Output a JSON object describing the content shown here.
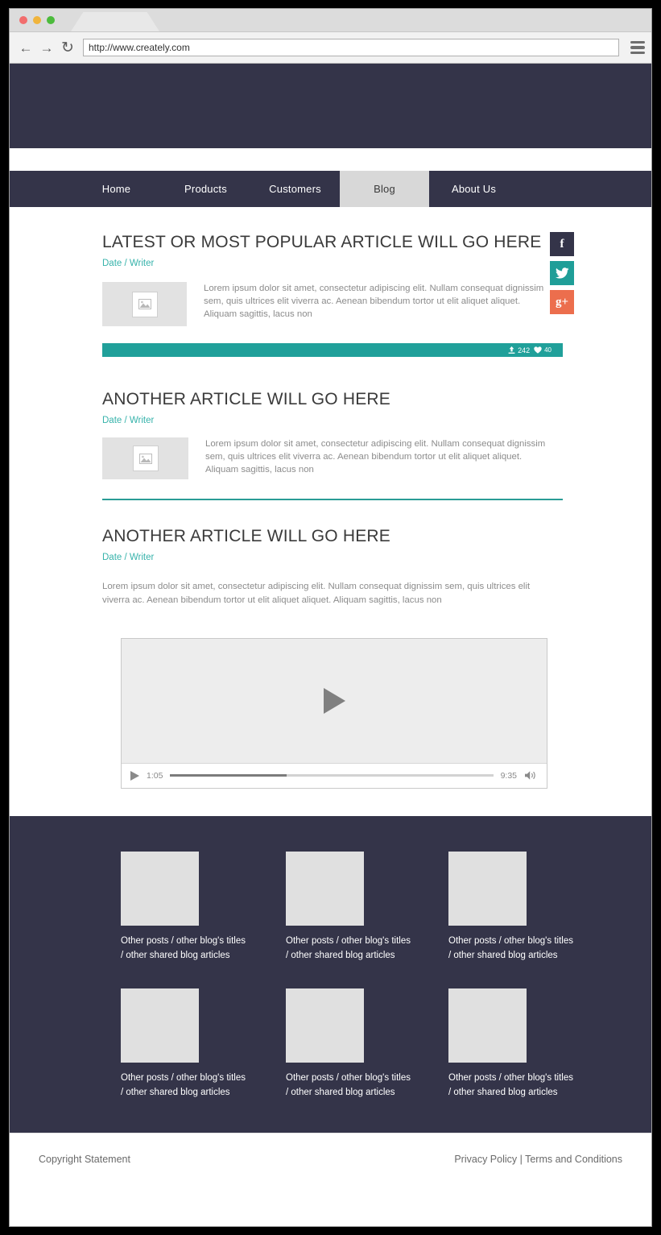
{
  "browser": {
    "url": "http://www.creately.com",
    "back_icon": "back-arrow-icon",
    "forward_icon": "forward-arrow-icon",
    "reload_icon": "reload-icon",
    "menu_icon": "hamburger-menu-icon",
    "lights": [
      "close-light",
      "minimize-light",
      "maximize-light"
    ]
  },
  "nav": {
    "items": [
      {
        "label": "Home",
        "active": false
      },
      {
        "label": "Products",
        "active": false
      },
      {
        "label": "Customers",
        "active": false
      },
      {
        "label": "Blog",
        "active": true
      },
      {
        "label": "About Us",
        "active": false
      }
    ]
  },
  "social": [
    {
      "name": "facebook-share-button",
      "glyph": "f",
      "color": "#343449"
    },
    {
      "name": "twitter-share-button",
      "glyph": "♥",
      "color": "#1f9e98"
    },
    {
      "name": "googleplus-share-button",
      "glyph": "g+",
      "color": "#ec6e4d"
    }
  ],
  "articles": [
    {
      "title": "LATEST OR MOST POPULAR ARTICLE WILL GO HERE",
      "byline": "Date / Writer",
      "body": "Lorem ipsum dolor sit amet, consectetur adipiscing elit. Nullam consequat dignissim sem, quis ultrices elit viverra ac. Aenean bibendum tortor ut elit aliquet aliquet. Aliquam sagittis, lacus non"
    },
    {
      "title": "ANOTHER ARTICLE WILL GO HERE",
      "byline": "Date / Writer",
      "body": "Lorem ipsum dolor sit amet, consectetur adipiscing elit. Nullam consequat dignissim sem, quis ultrices elit viverra ac. Aenean bibendum tortor ut elit aliquet aliquet. Aliquam sagittis, lacus non"
    },
    {
      "title": "ANOTHER ARTICLE WILL GO HERE",
      "byline": "Date / Writer",
      "body": "Lorem ipsum dolor sit amet, consectetur adipiscing elit. Nullam consequat dignissim sem, quis ultrices elit viverra ac. Aenean bibendum tortor ut elit aliquet aliquet. Aliquam sagittis, lacus non"
    }
  ],
  "stats": {
    "shares": "242",
    "likes": "40",
    "share_icon": "upload-share-icon",
    "like_icon": "heart-icon",
    "bar_color": "#20a09a"
  },
  "video": {
    "play_icon": "play-icon",
    "current_time": "1:05",
    "duration": "9:35",
    "volume_icon": "volume-icon",
    "progress_percent": "36"
  },
  "footer": {
    "cards": [
      {
        "caption": "Other posts / other blog's titles / other shared blog articles"
      },
      {
        "caption": "Other posts / other blog's titles / other shared blog articles"
      },
      {
        "caption": "Other posts / other blog's titles / other shared blog articles"
      },
      {
        "caption": "Other posts / other blog's titles / other shared blog articles"
      },
      {
        "caption": "Other posts / other blog's titles / other shared blog articles"
      },
      {
        "caption": "Other posts / other blog's titles / other shared blog articles"
      }
    ]
  },
  "bottombar": {
    "copyright": "Copyright Statement",
    "links": "Privacy Policy | Terms and Conditions"
  },
  "theme": {
    "dark": "#343449",
    "teal": "#20a09a",
    "teal_text": "#37b3ab",
    "orange": "#ec6e4d"
  }
}
